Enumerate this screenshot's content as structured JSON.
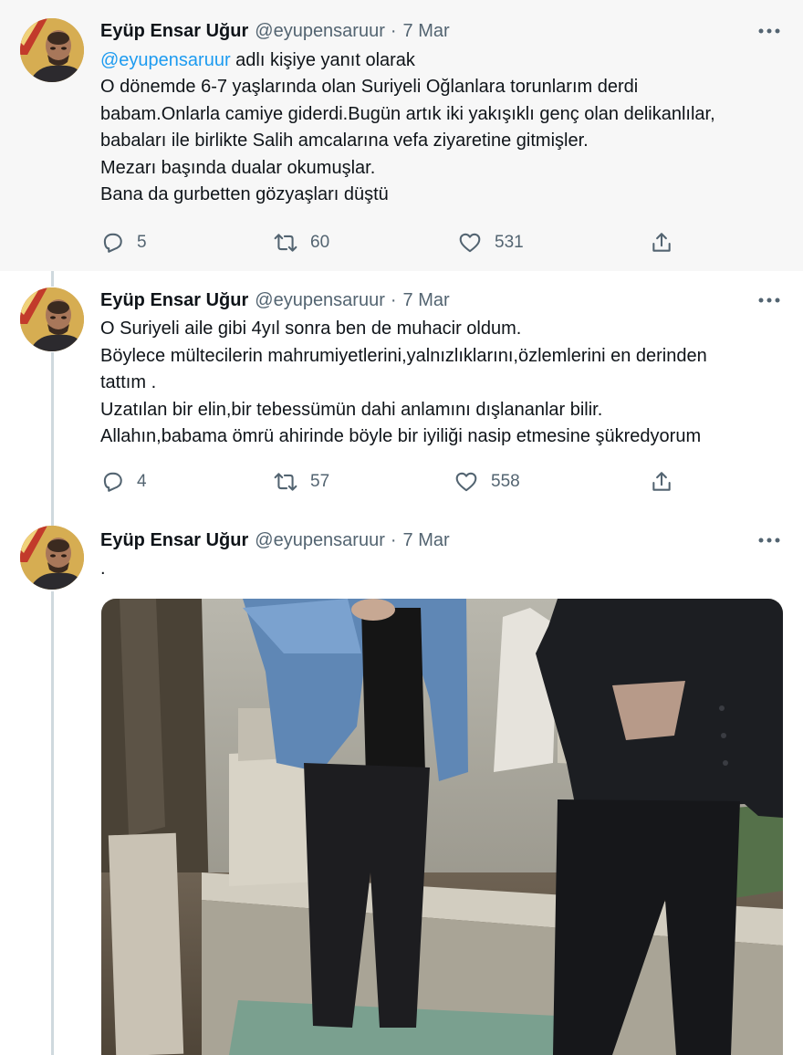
{
  "tweets": [
    {
      "author": {
        "name": "Eyüp Ensar Uğur",
        "handle": "@eyupensaruur"
      },
      "date": "7 Mar",
      "reply": {
        "mention": "@eyupensaruur",
        "suffix": " adlı kişiye yanıt olarak"
      },
      "text": "O dönemde 6-7 yaşlarında olan Suriyeli Oğlanlara torunlarım derdi\nbabam.Onlarla camiye giderdi.Bugün artık iki yakışıklı genç olan delikanlılar,\nbabaları ile birlikte Salih amcalarına vefa ziyaretine gitmişler.\nMezarı başında dualar okumuşlar.\nBana da gurbetten gözyaşları düştü",
      "stats": {
        "replies": "5",
        "retweets": "60",
        "likes": "531"
      }
    },
    {
      "author": {
        "name": "Eyüp Ensar Uğur",
        "handle": "@eyupensaruur"
      },
      "date": "7 Mar",
      "text": "O Suriyeli aile gibi 4yıl sonra ben de muhacir oldum.\nBöylece mültecilerin mahrumiyetlerini,yalnızlıklarını,özlemlerini en derinden\ntattım .\nUzatılan bir elin,bir tebessümün dahi anlamını dışlananlar bilir.\nAllahın,babama ömrü ahirinde böyle bir iyiliği nasip etmesine şükredyorum",
      "stats": {
        "replies": "4",
        "retweets": "57",
        "likes": "558"
      }
    },
    {
      "author": {
        "name": "Eyüp Ensar Uğur",
        "handle": "@eyupensaruur"
      },
      "date": "7 Mar",
      "text": "."
    }
  ],
  "separator": "·",
  "icons": [
    "more-icon",
    "reply-icon",
    "retweet-icon",
    "like-icon",
    "share-icon"
  ],
  "colors": {
    "mention": "#1d9bf0",
    "secondary": "#536471",
    "thread_line": "#cfd9de",
    "highlight_bg": "#f7f7f7"
  }
}
